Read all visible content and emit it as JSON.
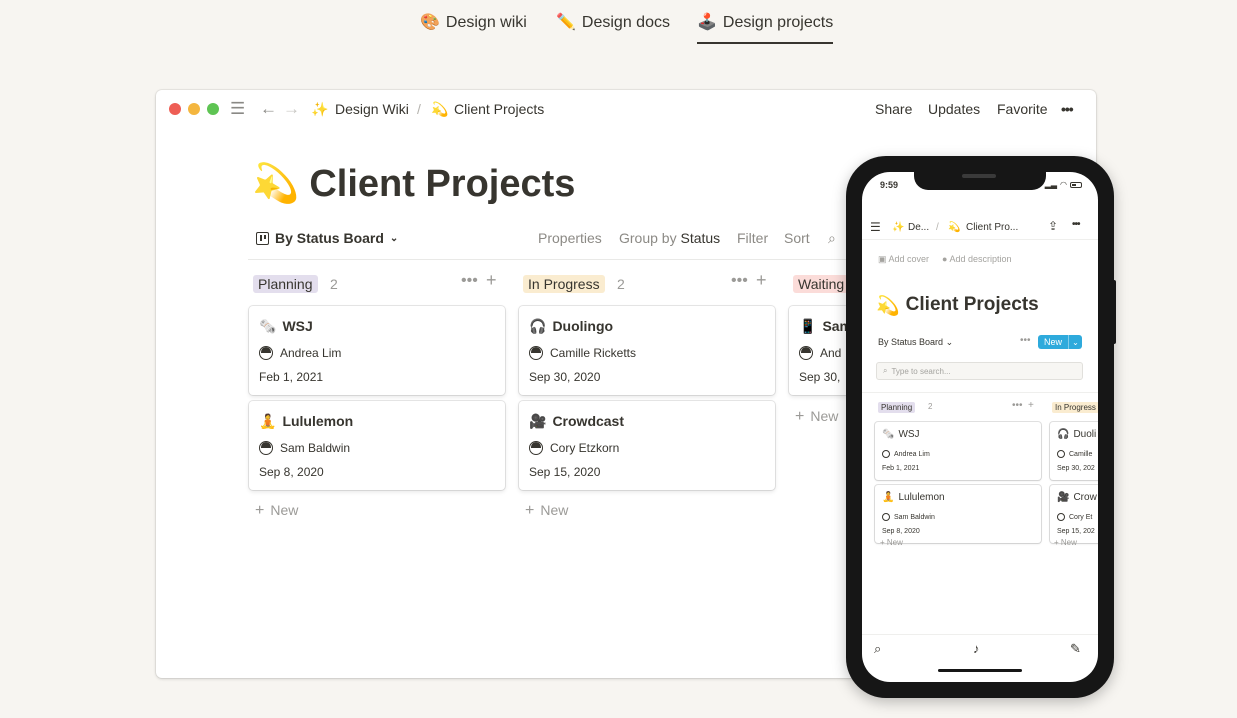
{
  "tabs": [
    {
      "icon": "🎨",
      "label": "Design wiki"
    },
    {
      "icon": "✏️",
      "label": "Design docs"
    },
    {
      "icon": "🕹️",
      "label": "Design projects"
    }
  ],
  "window": {
    "breadcrumb": [
      {
        "icon": "✨",
        "label": "Design Wiki"
      },
      {
        "icon": "💫",
        "label": "Client Projects"
      }
    ],
    "separator": "/",
    "actions": {
      "share": "Share",
      "updates": "Updates",
      "favorite": "Favorite",
      "more": "•••"
    },
    "page": {
      "icon": "💫",
      "title": "Client Projects"
    },
    "view": {
      "name": "By Status Board",
      "properties": "Properties",
      "group_by_prefix": "Group by",
      "group_by_value": "Status",
      "filter": "Filter",
      "sort": "Sort"
    },
    "columns": [
      {
        "tag": "Planning",
        "tag_bg": "#e3deed",
        "count": "2",
        "cards": [
          {
            "icon": "🗞️",
            "title": "WSJ",
            "person": "Andrea Lim",
            "date": "Feb 1, 2021"
          },
          {
            "icon": "🧘",
            "title": "Lululemon",
            "person": "Sam Baldwin",
            "date": "Sep 8, 2020"
          }
        ],
        "new": "New"
      },
      {
        "tag": "In Progress",
        "tag_bg": "#faecd0",
        "count": "2",
        "cards": [
          {
            "icon": "🎧",
            "title": "Duolingo",
            "person": "Camille Ricketts",
            "date": "Sep 30, 2020"
          },
          {
            "icon": "🎥",
            "title": "Crowdcast",
            "person": "Cory Etzkorn",
            "date": "Sep 15, 2020"
          }
        ],
        "new": "New"
      },
      {
        "tag": "Waiting",
        "tag_bg": "#fbdcd9",
        "count": "",
        "cards": [
          {
            "icon": "📱",
            "title": "Sam",
            "person": "And",
            "date": "Sep 30,"
          }
        ],
        "new": "New"
      }
    ]
  },
  "phone": {
    "time": "9:59",
    "breadcrumb": [
      {
        "icon": "✨",
        "label": "De..."
      },
      {
        "icon": "💫",
        "label": "Client Pro..."
      }
    ],
    "add_cover": "Add cover",
    "add_description": "Add description",
    "page": {
      "icon": "💫",
      "title": "Client Projects"
    },
    "view_name": "By Status Board",
    "more": "•••",
    "new_button": "New",
    "search_placeholder": "Type to search...",
    "columns": [
      {
        "tag": "Planning",
        "tag_bg": "#e3deed",
        "count": "2",
        "cards": [
          {
            "icon": "🗞️",
            "title": "WSJ",
            "person": "Andrea Lim",
            "date": "Feb 1, 2021"
          },
          {
            "icon": "🧘",
            "title": "Lululemon",
            "person": "Sam Baldwin",
            "date": "Sep 8, 2020"
          }
        ],
        "new": "New"
      },
      {
        "tag": "In Progress",
        "tag_bg": "#faecd0",
        "cards": [
          {
            "icon": "🎧",
            "title": "Duoli",
            "person": "Camille",
            "date": "Sep 30, 202"
          },
          {
            "icon": "🎥",
            "title": "Crow",
            "person": "Cory Et",
            "date": "Sep 15, 202"
          }
        ],
        "new": "New"
      }
    ]
  },
  "colors": {
    "text": "#37352f",
    "muted": "#9b9a97",
    "accent": "#2eaadc",
    "background": "#f7f5f1"
  },
  "icons": [
    "hamburger-icon",
    "back-arrow-icon",
    "forward-arrow-icon",
    "board-icon",
    "search-icon",
    "plus-icon",
    "share-icon",
    "bell-icon",
    "compose-icon"
  ]
}
